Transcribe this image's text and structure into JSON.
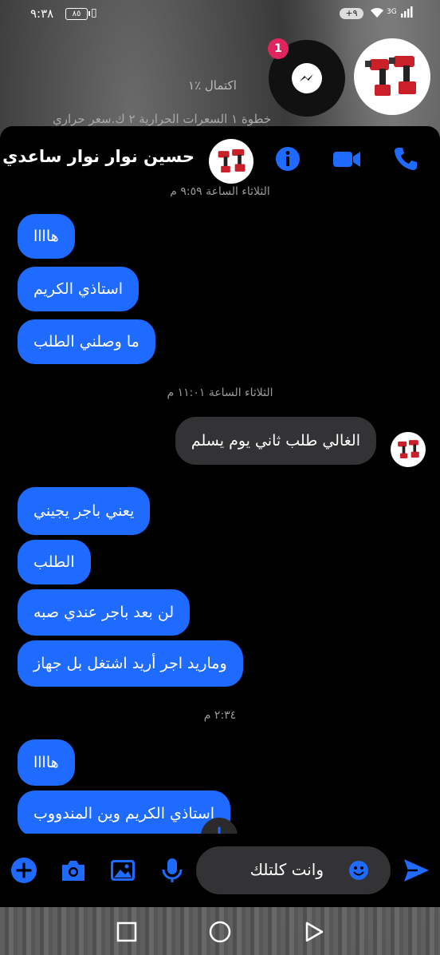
{
  "status_bar": {
    "time": "٩:٣٨",
    "battery": "٨٥",
    "notifications": "+٩",
    "network": "3G"
  },
  "background_app": {
    "progress": "اكتمال ٪١",
    "step": "خطوة ١ السعرات الحرارية ٢ ك.سعر حراري"
  },
  "chat_heads": {
    "messenger_unread": "1",
    "messenger_icon": "messenger-icon",
    "product_icon": "power-tools-image"
  },
  "header": {
    "name": "حسين نوار نوار ساعدي",
    "actions": [
      "info-icon",
      "video-call-icon",
      "phone-icon"
    ]
  },
  "messages": {
    "timestamp_top": "الثلاثاء الساعة ٩:٥٩ م",
    "group1": [
      "هاااا",
      "استاذي الكريم",
      "ما وصلني الطلب"
    ],
    "timestamp_mid": "الثلاثاء الساعة ١١:٠١ م",
    "mine": "الغالي طلب ثاني يوم يسلم",
    "group2": [
      "يعني باجر يجيني",
      "الطلب",
      "لن بعد باجر عندي صبه",
      "وماريد اجر أريد اشتغل بل جهاز"
    ],
    "timestamp_last": "٢:٣٤ م",
    "group3": [
      "هاااا",
      "استاذي الكريم وين المندووب"
    ]
  },
  "composer": {
    "input_text": "وانت كلتلك",
    "actions": [
      "plus-icon",
      "camera-icon",
      "image-icon",
      "microphone-icon",
      "send-icon"
    ]
  },
  "colors": {
    "accent": "#1f6bff",
    "incoming_bubble": "#1f6bff",
    "outgoing_bubble": "#333335",
    "badge": "#e0245e"
  }
}
